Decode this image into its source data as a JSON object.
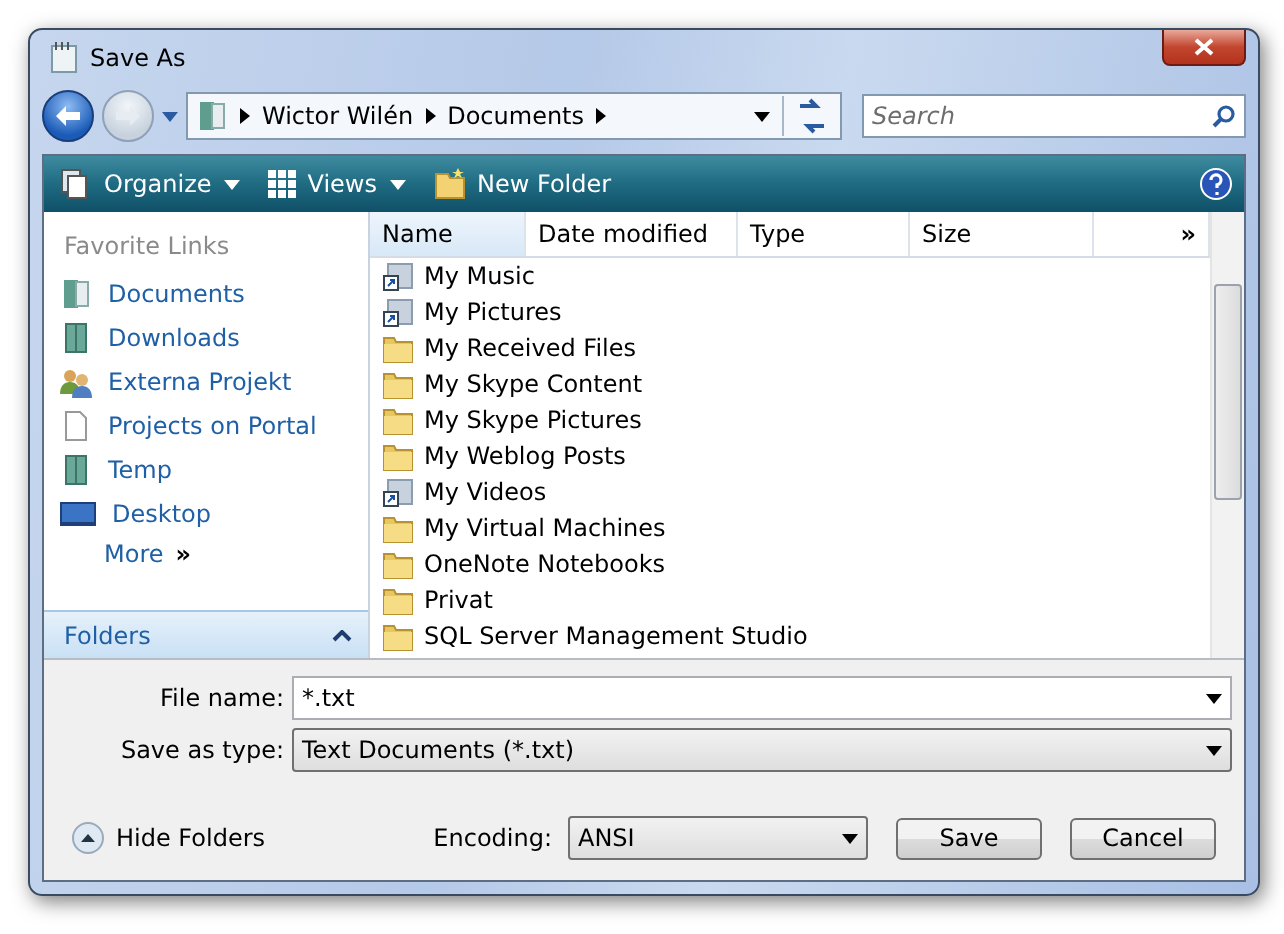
{
  "window": {
    "title": "Save As"
  },
  "address": {
    "crumbs": [
      "Wictor Wilén",
      "Documents"
    ]
  },
  "search": {
    "placeholder": "Search"
  },
  "toolbar": {
    "buttons": [
      {
        "label": "Organize",
        "kind": "organize",
        "menu": true
      },
      {
        "label": "Views",
        "kind": "views",
        "menu": true
      },
      {
        "label": "New Folder",
        "kind": "newfolder",
        "menu": false
      }
    ]
  },
  "sidebar": {
    "heading": "Favorite Links",
    "items": [
      {
        "label": "Documents",
        "kind": "documents"
      },
      {
        "label": "Downloads",
        "kind": "book"
      },
      {
        "label": "Externa Projekt",
        "kind": "people"
      },
      {
        "label": "Projects on Portal",
        "kind": "file"
      },
      {
        "label": "Temp",
        "kind": "book"
      },
      {
        "label": "Desktop",
        "kind": "desktop"
      }
    ],
    "more": "More",
    "more_glyph": "»",
    "folders": "Folders",
    "folders_expanded": true
  },
  "table": {
    "columns": [
      {
        "label": "Name",
        "sorted": true
      },
      {
        "label": "Date modified",
        "sorted": false
      },
      {
        "label": "Type",
        "sorted": false
      },
      {
        "label": "Size",
        "sorted": false
      }
    ],
    "more_glyph": "»",
    "rows": [
      {
        "name": "My Music",
        "kind": "shortcut"
      },
      {
        "name": "My Pictures",
        "kind": "shortcut"
      },
      {
        "name": "My Received Files",
        "kind": "folder"
      },
      {
        "name": "My Skype Content",
        "kind": "folder"
      },
      {
        "name": "My Skype Pictures",
        "kind": "folder"
      },
      {
        "name": "My Weblog Posts",
        "kind": "folder"
      },
      {
        "name": "My Videos",
        "kind": "shortcut"
      },
      {
        "name": "My Virtual Machines",
        "kind": "folder"
      },
      {
        "name": "OneNote Notebooks",
        "kind": "folder"
      },
      {
        "name": "Privat",
        "kind": "folder"
      },
      {
        "name": "SQL Server Management Studio",
        "kind": "folder"
      }
    ]
  },
  "form": {
    "file_name_label": "File name:",
    "file_name": "*.txt",
    "type_label": "Save as type:",
    "type": "Text Documents (*.txt)"
  },
  "footer": {
    "hide_folders": "Hide Folders",
    "encoding_label": "Encoding:",
    "encoding": "ANSI",
    "buttons": [
      "Save",
      "Cancel"
    ]
  }
}
